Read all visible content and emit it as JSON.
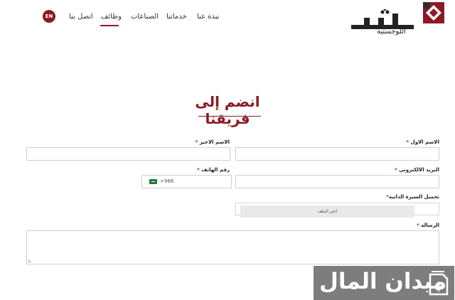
{
  "brand": {
    "name": "تمر",
    "tagline": "اللوجستية",
    "colors": {
      "primary": "#8b1a24",
      "text": "#333333"
    }
  },
  "nav": {
    "items": [
      {
        "label": "نبذة عنا"
      },
      {
        "label": "خدماتنا"
      },
      {
        "label": "الصناعات"
      },
      {
        "label": "وظائف",
        "active": true
      },
      {
        "label": "اتصل بنا"
      }
    ],
    "lang_button": "EN"
  },
  "page": {
    "title": "انضم إلى فريقنا"
  },
  "form": {
    "first_name": {
      "label": "الاسم الاول",
      "required_mark": "*",
      "value": ""
    },
    "last_name": {
      "label": "الاسم الاخير",
      "required_mark": "*",
      "value": ""
    },
    "email": {
      "label": "البريد الالكتروني",
      "required_mark": "*",
      "value": ""
    },
    "phone": {
      "label": "رقم الهاتف",
      "required_mark": "*",
      "country_code": "+966",
      "flag_icon": "saudi-flag-icon",
      "value": ""
    },
    "cv": {
      "label": "تحميل السيرة الذاتية",
      "required_mark": "*",
      "button_label": "اختر الملف"
    },
    "message": {
      "label": "الرسالة",
      "required_mark": "*",
      "value": ""
    }
  },
  "watermark": {
    "text": "ميدان المال",
    "icon": "money-tag-icon"
  }
}
